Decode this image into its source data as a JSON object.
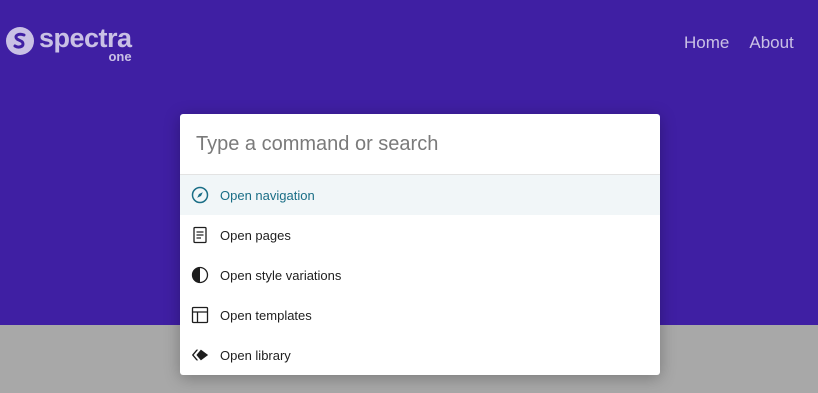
{
  "site": {
    "logo_word": "spectra",
    "logo_sub": "one",
    "nav": [
      {
        "label": "Home"
      },
      {
        "label": "About"
      }
    ]
  },
  "palette": {
    "placeholder": "Type a command or search",
    "items": [
      {
        "label": "Open navigation",
        "icon": "compass-icon",
        "active": true
      },
      {
        "label": "Open pages",
        "icon": "page-icon",
        "active": false
      },
      {
        "label": "Open style variations",
        "icon": "half-circle-icon",
        "active": false
      },
      {
        "label": "Open templates",
        "icon": "layout-icon",
        "active": false
      },
      {
        "label": "Open library",
        "icon": "diamond-icon",
        "active": false
      }
    ]
  },
  "colors": {
    "hero_bg": "#3f1fa3",
    "lower_bg": "#a8a8a8",
    "active_text": "#1a6e86"
  }
}
